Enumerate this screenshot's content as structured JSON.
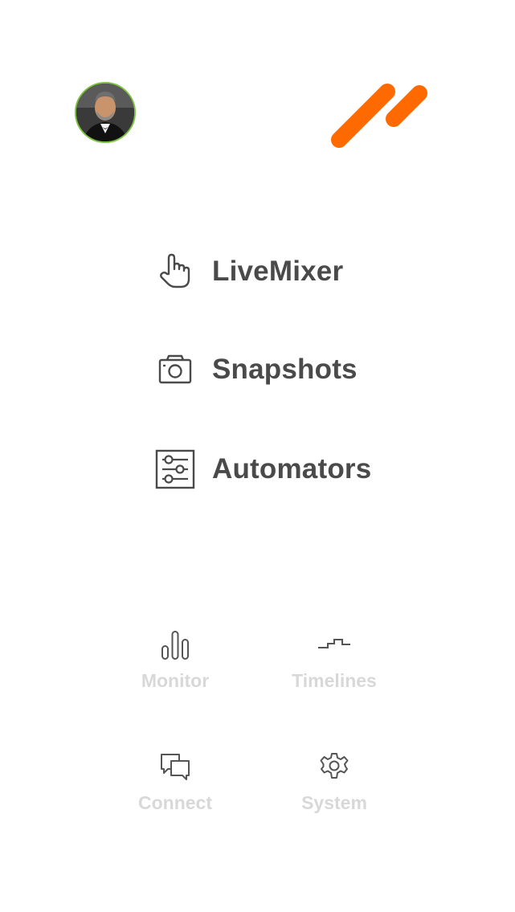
{
  "header": {
    "avatar_icon": "user-avatar-photo",
    "logo_icon": "double-slash-logo",
    "logo_color": "#ff6a00",
    "avatar_ring_color": "#7dc242"
  },
  "main_menu": [
    {
      "label": "LiveMixer",
      "icon": "hand-pointer-icon"
    },
    {
      "label": "Snapshots",
      "icon": "camera-icon"
    },
    {
      "label": "Automators",
      "icon": "sliders-icon"
    }
  ],
  "secondary_menu": [
    {
      "label": "Monitor",
      "icon": "bars-chart-icon"
    },
    {
      "label": "Timelines",
      "icon": "step-line-icon"
    },
    {
      "label": "Connect",
      "icon": "chat-bubbles-icon"
    },
    {
      "label": "System",
      "icon": "gear-icon"
    }
  ],
  "colors": {
    "main_text": "#4a4a4a",
    "secondary_text": "#d8d8d8",
    "icon_stroke": "#4a4a4a"
  }
}
